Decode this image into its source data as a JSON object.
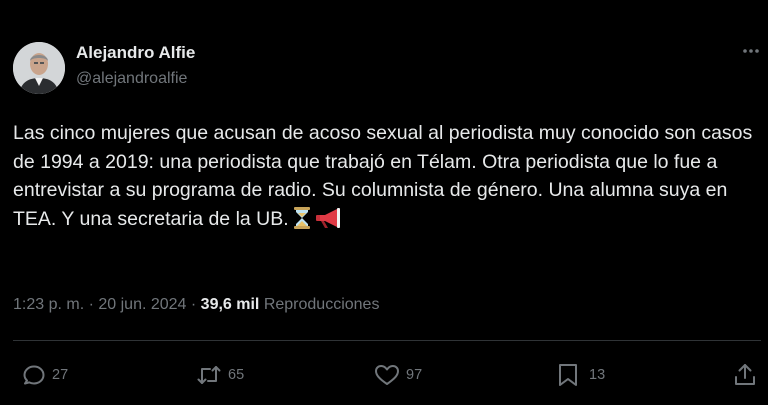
{
  "author": {
    "name": "Alejandro Alfie",
    "handle": "@alejandroalfie"
  },
  "tweet": {
    "text": "Las cinco mujeres que acusan de acoso sexual al periodista muy conocido son casos de 1994 a 2019: una periodista que trabajó en Télam. Otra periodista que lo fue a entrevistar a su programa de radio. Su columnista de género. Una alumna suya en TEA. Y una secretaria de la UB.",
    "emojis": [
      "hourglass-icon",
      "megaphone-icon"
    ]
  },
  "meta": {
    "time": "1:23 p. m.",
    "separator": " · ",
    "date": "20 jun. 2024",
    "views_count": "39,6 mil",
    "views_label": "Reproducciones"
  },
  "actions": {
    "replies": "27",
    "reposts": "65",
    "likes": "97",
    "bookmarks": "13"
  },
  "colors": {
    "background": "#000000",
    "text": "#e7e9ea",
    "secondary": "#71767b",
    "divider": "#2f3336"
  }
}
